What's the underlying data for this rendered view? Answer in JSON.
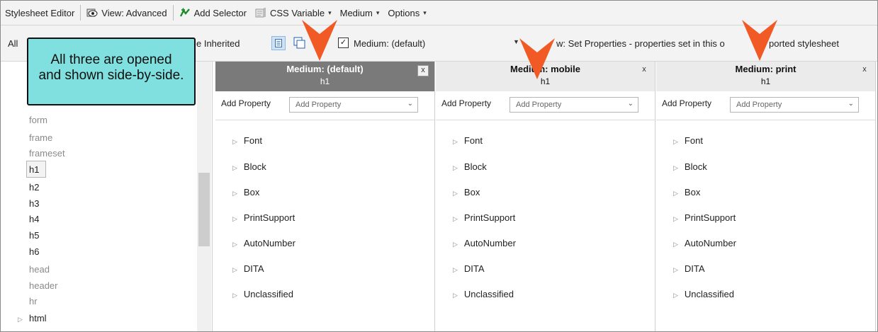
{
  "toolbar": {
    "stylesheet_editor": "Stylesheet Editor",
    "view": "View: Advanced",
    "add_selector": "Add Selector",
    "css_variable": "CSS Variable",
    "medium": "Medium",
    "options": "Options"
  },
  "toolbar2": {
    "all_fragment": "All",
    "inherited_fragment": "e Inherited",
    "medium_select": "Medium: (default)",
    "show_text": "w: Set Properties - properties set in this o",
    "show_text_end": "ported stylesheet"
  },
  "callout": {
    "line1": "All three are opened",
    "line2": "and shown side-by-side."
  },
  "selectors": {
    "form": "form",
    "frame": "frame",
    "frameset": "frameset",
    "h1": "h1",
    "h2": "h2",
    "h3": "h3",
    "h4": "h4",
    "h5": "h5",
    "h6": "h6",
    "head": "head",
    "header": "header",
    "hr": "hr",
    "html": "html"
  },
  "panels": [
    {
      "medium": "Medium: (default)",
      "selector": "h1",
      "add_label": "Add Property",
      "add_placeholder": "Add Property",
      "close": "x"
    },
    {
      "medium": "Medium: mobile",
      "selector": "h1",
      "add_label": "Add Property",
      "add_placeholder": "Add Property",
      "close": "x"
    },
    {
      "medium": "Medium: print",
      "selector": "h1",
      "add_label": "Add Property",
      "add_placeholder": "Add Property",
      "close": "x"
    }
  ],
  "categories": [
    "Font",
    "Block",
    "Box",
    "PrintSupport",
    "AutoNumber",
    "DITA",
    "Unclassified"
  ],
  "colors": {
    "callout_bg": "#7fe0df",
    "arrow": "#f15a24",
    "active_header": "#7a7a7a",
    "inactive_header": "#ebebeb"
  }
}
